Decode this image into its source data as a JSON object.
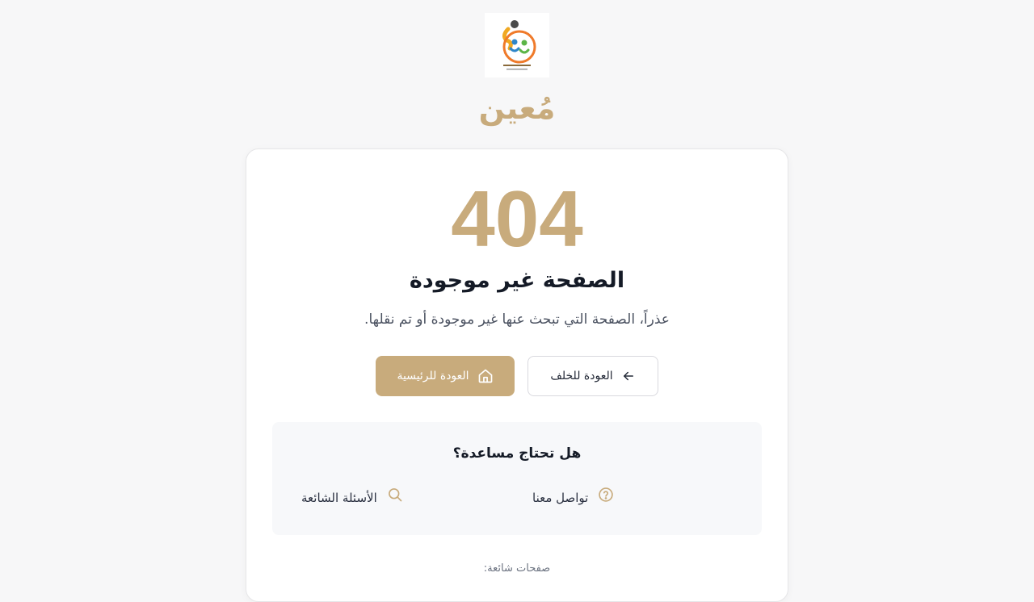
{
  "brand": {
    "name": "مُعين",
    "logo_text": "مركز الهمم"
  },
  "error": {
    "code": "404",
    "title": "الصفحة غير موجودة",
    "description": "عذراً، الصفحة التي تبحث عنها غير موجودة أو تم نقلها."
  },
  "actions": {
    "home_label": "العودة للرئيسية",
    "back_label": "العودة للخلف"
  },
  "help": {
    "title": "هل تحتاج مساعدة؟",
    "contact_label": "تواصل معنا",
    "faq_label": "الأسئلة الشائعة"
  },
  "popular": {
    "label": "صفحات شائعة:"
  },
  "colors": {
    "accent": "#c8ab7c",
    "background": "#f7f7f8",
    "card": "#ffffff",
    "help_panel": "#f7f8fa"
  },
  "icons": {
    "home": "home-icon",
    "back": "arrow-left-icon",
    "contact": "help-circle-icon",
    "faq": "search-icon"
  }
}
